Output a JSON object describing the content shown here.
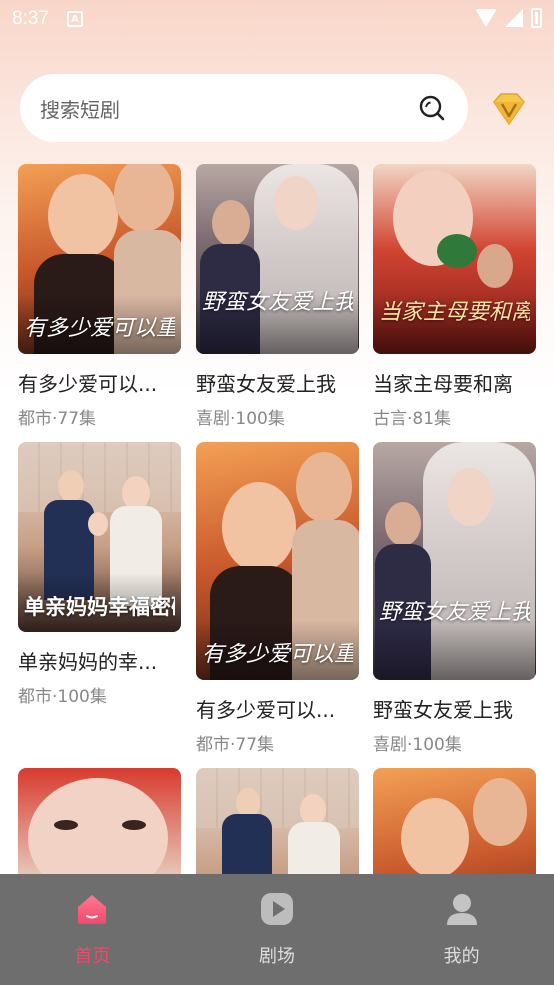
{
  "status_bar": {
    "time": "8:37",
    "notification_glyph": "A"
  },
  "search": {
    "placeholder": "搜索短剧"
  },
  "colors": {
    "accent": "#f2486b",
    "nav_bg": "#6e6e6e"
  },
  "dramas": [
    {
      "title": "有多少爱可以...",
      "meta": "都市·77集",
      "poster_text": "有多少爱可以重来"
    },
    {
      "title": "野蛮女友爱上我",
      "meta": "喜剧·100集",
      "poster_text": "野蛮女友爱上我"
    },
    {
      "title": "当家主母要和离",
      "meta": "古言·81集",
      "poster_text": "当家主母要和离"
    },
    {
      "title": "单亲妈妈的幸...",
      "meta": "都市·100集",
      "poster_text": "单亲妈妈幸福密码"
    },
    {
      "title": "有多少爱可以...",
      "meta": "都市·77集",
      "poster_text": "有多少爱可以重来"
    },
    {
      "title": "野蛮女友爱上我",
      "meta": "喜剧·100集",
      "poster_text": "野蛮女友爱上我"
    }
  ],
  "nav": [
    {
      "label": "首页",
      "icon": "home-icon",
      "active": true
    },
    {
      "label": "剧场",
      "icon": "play-icon",
      "active": false
    },
    {
      "label": "我的",
      "icon": "profile-icon",
      "active": false
    }
  ]
}
